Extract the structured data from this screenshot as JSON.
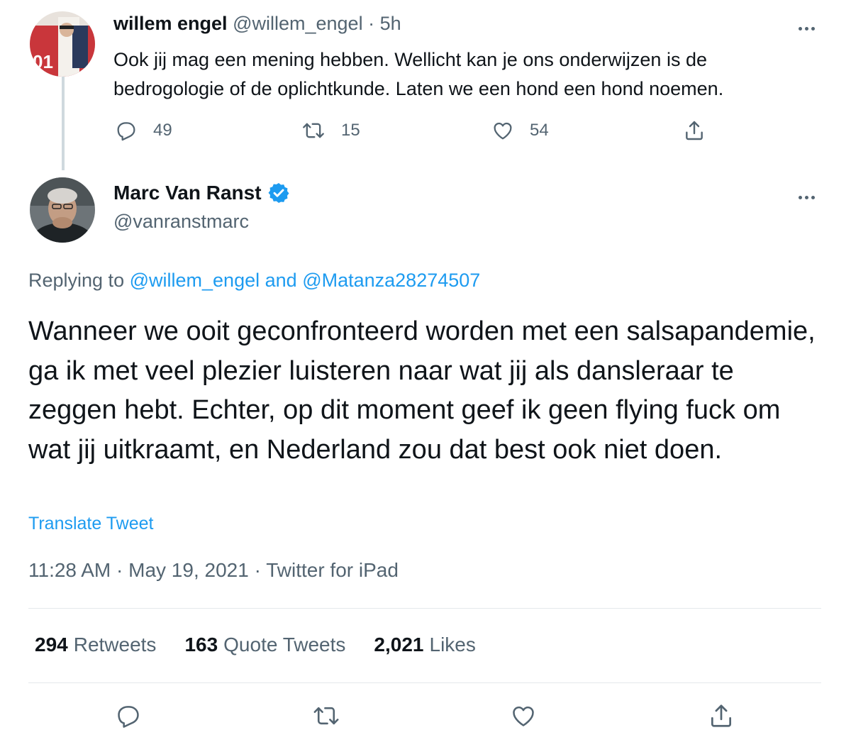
{
  "parent_tweet": {
    "author_name": "willem engel",
    "author_handle": "@willem_engel",
    "separator": "·",
    "time_ago": "5h",
    "text": "Ook jij mag een mening hebben. Wellicht kan je ons onderwijzen is de bedrogologie of de oplichtkunde. Laten we een hond een hond noemen.",
    "replies": "49",
    "retweets": "15",
    "likes": "54"
  },
  "main_tweet": {
    "author_name": "Marc Van Ranst",
    "author_handle": "@vanranstmarc",
    "verified": true,
    "replying_prefix": "Replying to",
    "replying_user1": "@willem_engel",
    "replying_and": "and",
    "replying_user2": "@Matanza28274507",
    "text": "Wanneer we ooit geconfronteerd worden met een salsapandemie, ga ik met veel plezier luisteren naar wat jij als dansleraar te zeggen hebt. Echter, op dit moment geef ik geen flying fuck om wat jij uitkraamt, en Nederland zou dat best ook niet doen.",
    "translate_label": "Translate Tweet",
    "time": "11:28 AM",
    "date": "May 19, 2021",
    "source": "Twitter for iPad",
    "meta_separator": "·",
    "stats": {
      "retweets_count": "294",
      "retweets_label": "Retweets",
      "quotes_count": "163",
      "quotes_label": "Quote Tweets",
      "likes_count": "2,021",
      "likes_label": "Likes"
    }
  },
  "colors": {
    "accent": "#1d9bf0",
    "muted": "#536471",
    "text": "#0f1419",
    "divider": "#e4e8eb"
  },
  "icons": [
    "reply-icon",
    "retweet-icon",
    "like-icon",
    "share-icon",
    "more-icon",
    "verified-badge-icon"
  ]
}
